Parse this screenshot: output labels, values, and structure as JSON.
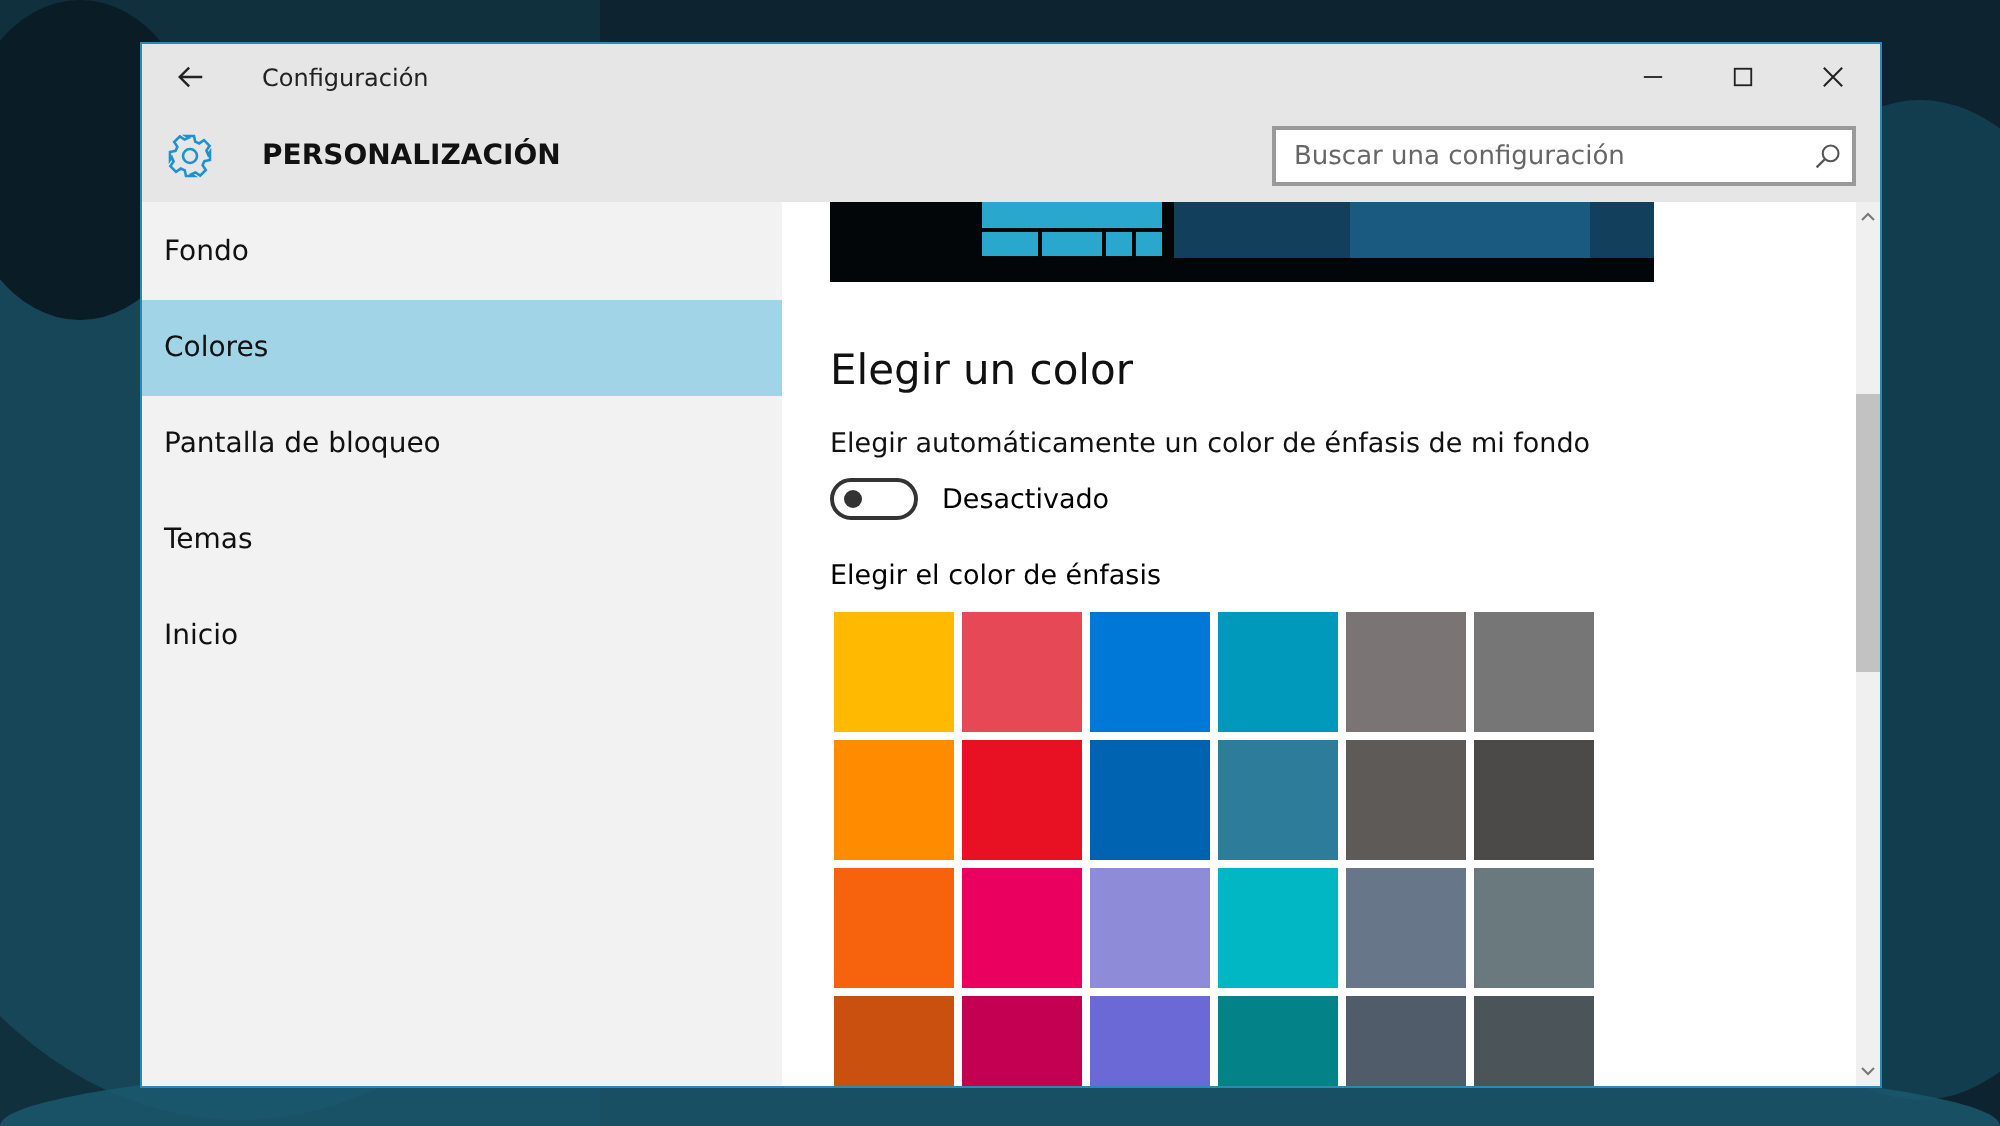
{
  "window": {
    "title": "Configuración",
    "section": "PERSONALIZACIÓN"
  },
  "search": {
    "placeholder": "Buscar una configuración"
  },
  "sidebar": {
    "items": [
      {
        "label": "Fondo",
        "selected": false
      },
      {
        "label": "Colores",
        "selected": true
      },
      {
        "label": "Pantalla de bloqueo",
        "selected": false
      },
      {
        "label": "Temas",
        "selected": false
      },
      {
        "label": "Inicio",
        "selected": false
      }
    ]
  },
  "content": {
    "heading": "Elegir un color",
    "auto_label": "Elegir automáticamente un color de énfasis de mi fondo",
    "toggle": {
      "on": false,
      "status": "Desactivado"
    },
    "accent_label": "Elegir el color de énfasis",
    "swatches": [
      {
        "color": "#ffb900"
      },
      {
        "color": "#e74856"
      },
      {
        "color": "#0078d7"
      },
      {
        "color": "#0099bc"
      },
      {
        "color": "#7a7574"
      },
      {
        "color": "#767676"
      },
      {
        "color": "#ff8c00"
      },
      {
        "color": "#e81123"
      },
      {
        "color": "#0063b1"
      },
      {
        "color": "#2d7d9a"
      },
      {
        "color": "#5d5a58"
      },
      {
        "color": "#4c4a48"
      },
      {
        "color": "#f7630c"
      },
      {
        "color": "#ea005e"
      },
      {
        "color": "#8e8cd8"
      },
      {
        "color": "#00b7c3"
      },
      {
        "color": "#68768a"
      },
      {
        "color": "#69797e"
      },
      {
        "color": "#ca5010"
      },
      {
        "color": "#c30052"
      },
      {
        "color": "#6b69d6"
      },
      {
        "color": "#038387"
      },
      {
        "color": "#515c6b"
      },
      {
        "color": "#4a5459"
      }
    ]
  }
}
